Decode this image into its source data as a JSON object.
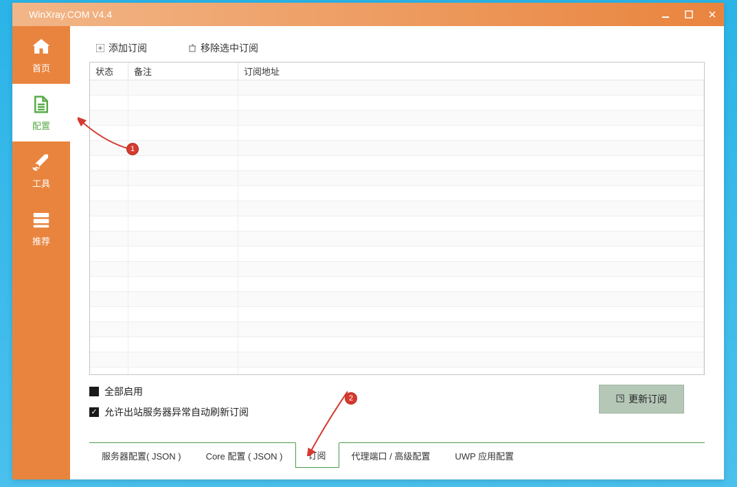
{
  "window": {
    "title": "WinXray.COM  V4.4"
  },
  "sidebar": {
    "items": [
      {
        "label": "首页",
        "icon": "home-icon"
      },
      {
        "label": "配置",
        "icon": "document-icon"
      },
      {
        "label": "工具",
        "icon": "wrench-icon"
      },
      {
        "label": "推荐",
        "icon": "server-icon"
      }
    ]
  },
  "toolbar": {
    "add_label": "添加订阅",
    "remove_label": "移除选中订阅"
  },
  "table": {
    "headers": {
      "status": "状态",
      "remark": "备注",
      "url": "订阅地址"
    }
  },
  "checkboxes": {
    "enable_all": "全部启用",
    "auto_refresh": "允许出站服务器异常自动刷新订阅"
  },
  "buttons": {
    "update": "更新订阅"
  },
  "tabs": [
    {
      "label": "服务器配置( JSON )"
    },
    {
      "label": "Core 配置 ( JSON )"
    },
    {
      "label": "订阅"
    },
    {
      "label": "代理端口 / 高级配置"
    },
    {
      "label": "UWP 应用配置"
    }
  ],
  "annotations": {
    "badge1": "1",
    "badge2": "2"
  }
}
